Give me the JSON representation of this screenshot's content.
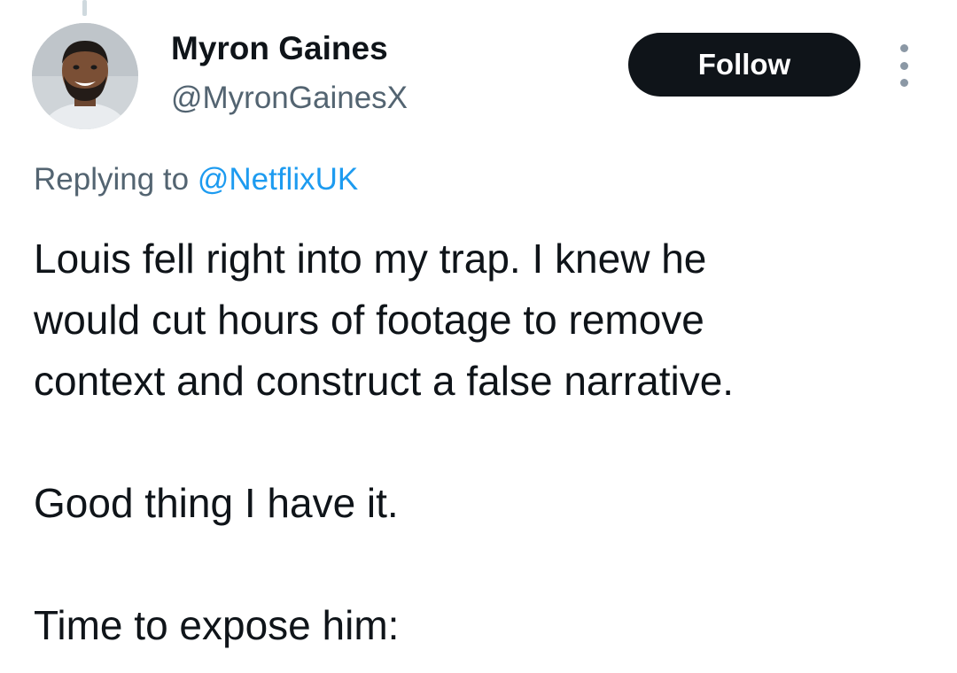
{
  "author": {
    "name": "Myron Gaines",
    "handle": "@MyronGainesX"
  },
  "follow_label": "Follow",
  "reply": {
    "prefix": "Replying to ",
    "mention": "@NetflixUK"
  },
  "tweet": {
    "line1": "Louis fell right into my trap. I knew he",
    "line2": "would cut hours of footage to remove",
    "line3": "context and construct a false narrative.",
    "line4": "Good thing I have it.",
    "line5": "Time to expose him:"
  },
  "colors": {
    "text": "#0f1419",
    "secondary": "#536471",
    "link": "#1d9bf0",
    "button_bg": "#0f1419",
    "button_text": "#ffffff"
  },
  "icons": {
    "more": "more-horizontal-dots-icon"
  }
}
